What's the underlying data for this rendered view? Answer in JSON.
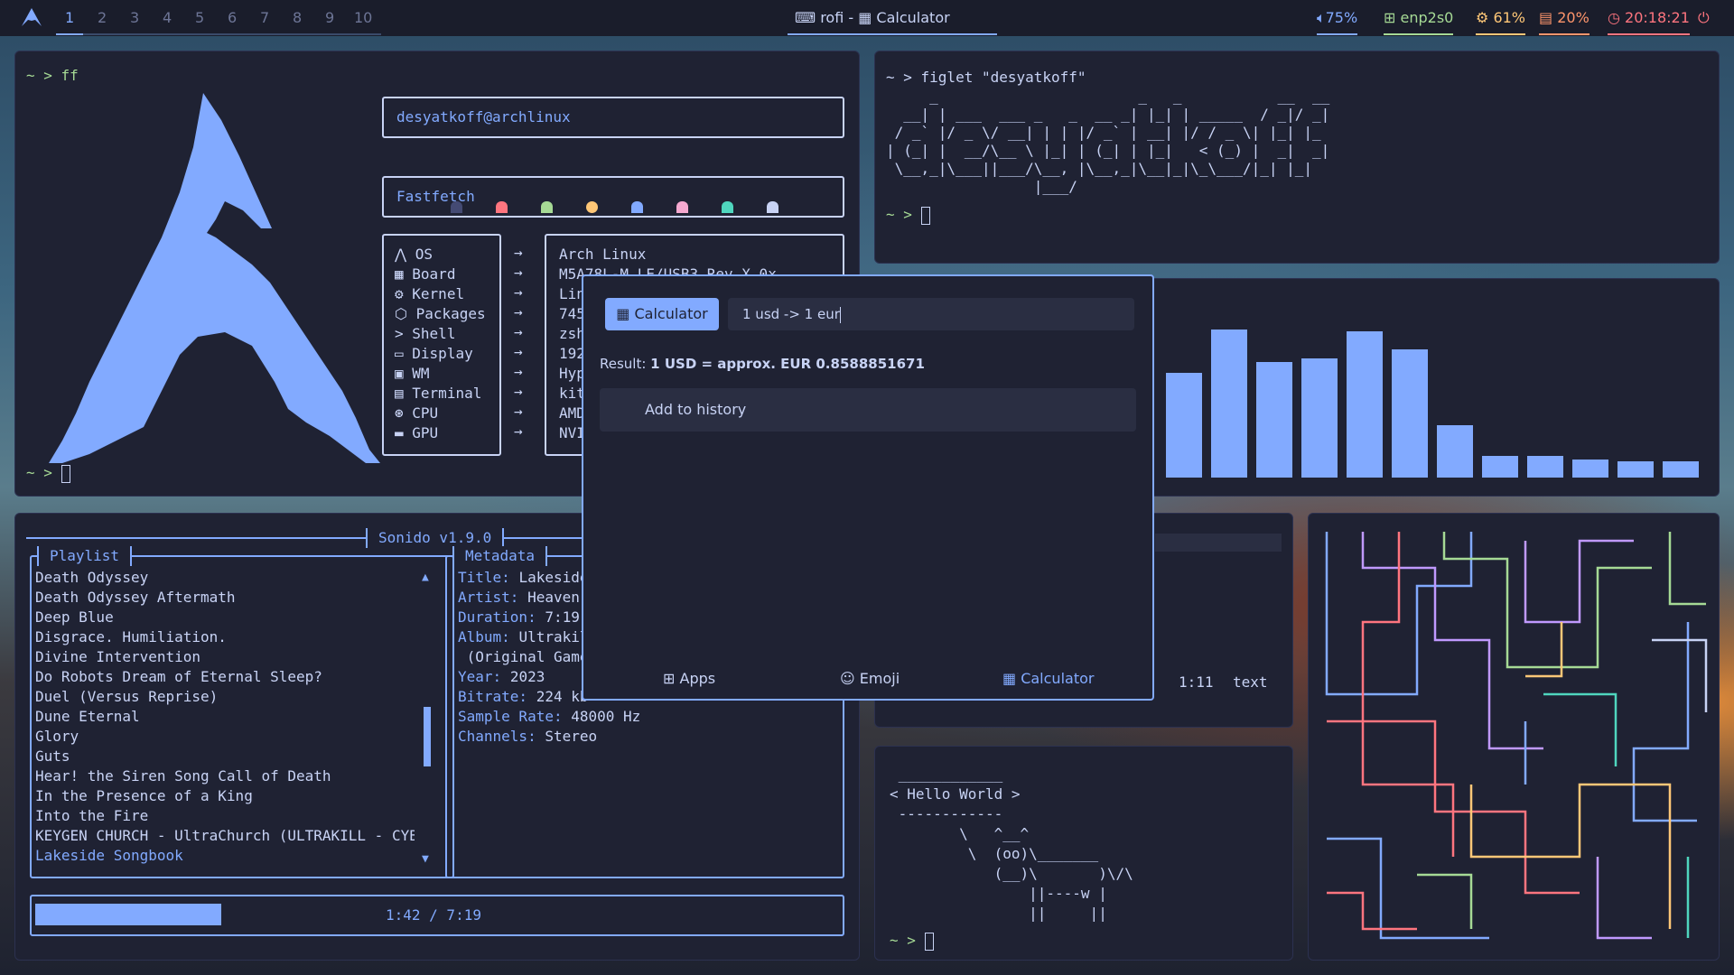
{
  "topbar": {
    "workspaces": [
      "1",
      "2",
      "3",
      "4",
      "5",
      "6",
      "7",
      "8",
      "9",
      "10"
    ],
    "active_workspace": "1",
    "window_title": "rofi - ▦ Calculator",
    "status": {
      "volume": "75%",
      "network": "enp2s0",
      "cpu": "61%",
      "memory": "20%",
      "clock": "20:18:21"
    }
  },
  "fastfetch": {
    "prompt": "~ > ff",
    "user_host": "desyatkoff@archlinux",
    "title": "Fastfetch",
    "labels": [
      "OS",
      "Board",
      "Kernel",
      "Packages",
      "Shell",
      "Display",
      "WM",
      "Terminal",
      "CPU",
      "GPU"
    ],
    "arrow": "→",
    "values": [
      "Arch Linux",
      "M5A78L-M LE/USB3 Rev X.0x",
      "Lin",
      "745",
      "zsh",
      "192",
      "Hyp",
      "kit",
      "AMD",
      "NVI"
    ],
    "prompt_bottom": "~ >"
  },
  "figlet": {
    "command": "~ > figlet \"desyatkoff\"",
    "art": [
      "     _                       _   _           __  __",
      "  __| | ___  ___ _   _  __ _| |_| | _____  / _|/ _|",
      " / _` |/ _ \\/ __| | | |/ _` | __| |/ / _ \\| |_| |_",
      "| (_| |  __/\\__ \\ |_| | (_| | |_|   < (_) |  _|  _|",
      " \\__,_|\\___||___/\\__, |\\__,_|\\__|_|\\_\\___/|_| |_|",
      "                 |___/"
    ],
    "prompt": "~ >"
  },
  "rofi": {
    "mode_label": "▦ Calculator",
    "input_value": "1 usd -> 1 eur",
    "result_prefix": "Result: ",
    "result_value": "1 USD = approx. EUR 0.8588851671",
    "item": "Add to history",
    "tabs": [
      "⊞ Apps",
      "☺ Emoji",
      "▦ Calculator"
    ]
  },
  "sonido": {
    "title": "Sonido v1.9.0",
    "playlist_title": "Playlist",
    "metadata_title": "Metadata",
    "playlist": [
      "Death Odyssey",
      "Death Odyssey Aftermath",
      "Deep Blue",
      "Disgrace. Humiliation.",
      "Divine Intervention",
      "Do Robots Dream of Eternal Sleep?",
      "Duel (Versus Reprise)",
      "Dune Eternal",
      "Glory",
      "Guts",
      "Hear! the Siren Song Call of Death",
      "In the Presence of a King",
      "Into the Fire",
      "KEYGEN CHURCH - UltraChurch (ULTRAKILL - CYB",
      "Lakeside Songbook"
    ],
    "selected_index": 14,
    "metadata": [
      {
        "k": "Title:",
        "v": "Lakeside"
      },
      {
        "k": "Artist:",
        "v": "Heaven"
      },
      {
        "k": "Duration:",
        "v": "7:19"
      },
      {
        "k": "Album:",
        "v": "Ultrakil"
      },
      {
        "k": "",
        "v": "(Original Game"
      },
      {
        "k": "Year:",
        "v": "2023"
      },
      {
        "k": "Bitrate:",
        "v": "224 kb"
      },
      {
        "k": "Sample Rate:",
        "v": "48000 Hz"
      },
      {
        "k": "Channels:",
        "v": "Stereo"
      }
    ],
    "progress_text": "1:42 / 7:19",
    "progress_fraction": 0.23
  },
  "visualizer": {
    "levels": [
      0.58,
      0.82,
      0.64,
      0.66,
      0.81,
      0.71,
      0.29,
      0.12,
      0.12,
      0.1,
      0.09,
      0.09
    ]
  },
  "editor_panel": {
    "position": "1:11",
    "mode": "text"
  },
  "cowsay": {
    "art": [
      " ____________",
      "< Hello World >",
      " ------------",
      "        \\   ^__^",
      "         \\  (oo)\\_______",
      "            (__)\\       )\\/\\",
      "                ||----w |",
      "                ||     ||"
    ],
    "prompt": "~ >"
  }
}
